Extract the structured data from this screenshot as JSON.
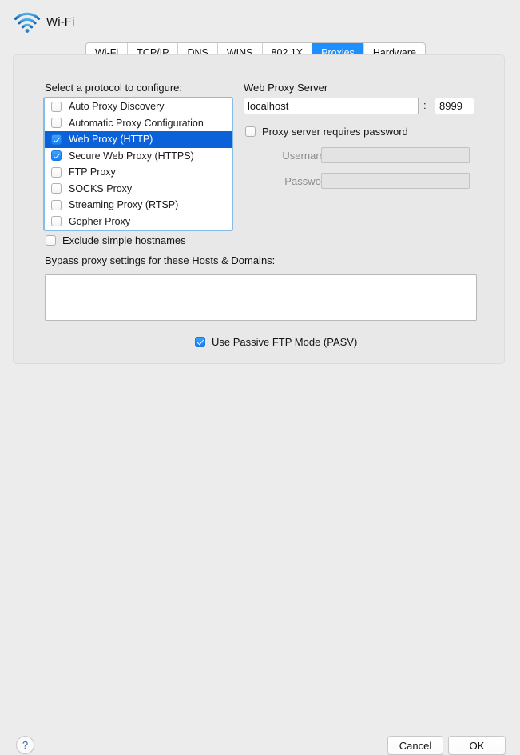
{
  "window": {
    "title": "Wi-Fi",
    "icon": "wifi-icon"
  },
  "tabs": [
    {
      "label": "Wi-Fi",
      "active": false
    },
    {
      "label": "TCP/IP",
      "active": false
    },
    {
      "label": "DNS",
      "active": false
    },
    {
      "label": "WINS",
      "active": false
    },
    {
      "label": "802.1X",
      "active": false
    },
    {
      "label": "Proxies",
      "active": true
    },
    {
      "label": "Hardware",
      "active": false
    }
  ],
  "protocol_section": {
    "label": "Select a protocol to configure:",
    "items": [
      {
        "label": "Auto Proxy Discovery",
        "checked": false,
        "selected": false
      },
      {
        "label": "Automatic Proxy Configuration",
        "checked": false,
        "selected": false
      },
      {
        "label": "Web Proxy (HTTP)",
        "checked": true,
        "selected": true
      },
      {
        "label": "Secure Web Proxy (HTTPS)",
        "checked": true,
        "selected": false
      },
      {
        "label": "FTP Proxy",
        "checked": false,
        "selected": false
      },
      {
        "label": "SOCKS Proxy",
        "checked": false,
        "selected": false
      },
      {
        "label": "Streaming Proxy (RTSP)",
        "checked": false,
        "selected": false
      },
      {
        "label": "Gopher Proxy",
        "checked": false,
        "selected": false
      }
    ]
  },
  "server_section": {
    "label": "Web Proxy Server",
    "host_value": "localhost",
    "host_placeholder": "",
    "port_separator": ":",
    "port_value": "8999",
    "requires_password_label": "Proxy server requires password",
    "requires_password_checked": false,
    "username_label": "Username:",
    "username_value": "",
    "password_label": "Password:",
    "password_value": ""
  },
  "bypass_section": {
    "exclude_label": "Exclude simple hostnames",
    "exclude_checked": false,
    "bypass_label": "Bypass proxy settings for these Hosts & Domains:",
    "bypass_value": ""
  },
  "passive_ftp": {
    "label": "Use Passive FTP Mode (PASV)",
    "checked": true
  },
  "footer": {
    "help_label": "?",
    "cancel_label": "Cancel",
    "ok_label": "OK"
  },
  "colors": {
    "accent_tab": "#1e8fff",
    "accent_selection": "#0a61d8",
    "checkbox_fill": "#1380f5",
    "focus_ring": "#84bbe8",
    "window_bg": "#ececec",
    "panel_bg": "#e8e8e8"
  }
}
